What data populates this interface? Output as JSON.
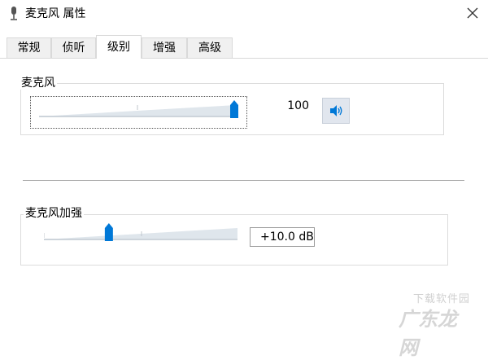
{
  "window": {
    "title": "麦克风 属性"
  },
  "tabs": [
    {
      "label": "常规",
      "active": false
    },
    {
      "label": "侦听",
      "active": false
    },
    {
      "label": "级别",
      "active": true
    },
    {
      "label": "增强",
      "active": false
    },
    {
      "label": "高级",
      "active": false
    }
  ],
  "levels": {
    "group_label": "麦克风",
    "slider_value": 100,
    "slider_max": 100,
    "value_label": "100",
    "mute_button_icon": "speaker-icon"
  },
  "boost": {
    "group_label": "麦克风加强",
    "slider_fraction": 0.33,
    "value_label": "+10.0 dB"
  },
  "watermark": {
    "top_text": "下载软件园",
    "main_text": "广东龙网"
  },
  "colors": {
    "accent": "#0078d7",
    "track": "#cdd4db",
    "track_fill": "#dfe6ec"
  }
}
